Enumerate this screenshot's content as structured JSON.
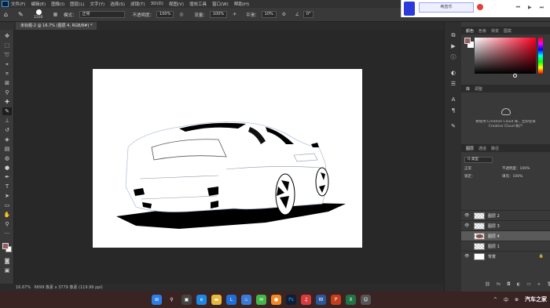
{
  "menubar": {
    "items": [
      "文件(F)",
      "编辑(E)",
      "图像(I)",
      "图层(L)",
      "文字(Y)",
      "选择(S)",
      "滤镜(T)",
      "3D(D)",
      "视图(V)",
      "增效工具",
      "窗口(W)",
      "帮助(H)"
    ]
  },
  "optbar": {
    "brush_size": "2200",
    "mode_label": "模式：",
    "mode_value": "正常",
    "opacity_label": "不透明度：",
    "opacity_value": "100%",
    "flow_label": "流量：",
    "flow_value": "100%",
    "smooth_label": "平滑：",
    "smooth_value": "10%",
    "angle_value": "0°"
  },
  "promo": {
    "name": "纯音乐"
  },
  "document": {
    "tab_title": "未标题-2 @ 16.7% (图层 4, RGB/8#) *"
  },
  "statusbar": {
    "zoom": "16.67%",
    "dimensions": "6699 像素 x 3779 像素 (119.99 ppi)"
  },
  "color_panel": {
    "tabs": [
      "颜色",
      "色板",
      "渐变",
      "图案"
    ],
    "fg_color": "#9a5a62",
    "bg_color": "#ffffff"
  },
  "library_panel": {
    "tabs": [
      "库",
      "调整"
    ],
    "message_line1": "要使用 Creative Cloud 库，立即登录",
    "message_line2": "Creative Cloud 帐户"
  },
  "layers_panel": {
    "tabs": [
      "图层",
      "通道",
      "路径"
    ],
    "filter": "Q 类型",
    "blend": "正常",
    "opacity": "不透明度：100%",
    "lock": "锁定：",
    "fill": "填充：100%",
    "layers": [
      {
        "name": "图层 2",
        "thumb": "check",
        "selected": false
      },
      {
        "name": "图层 3",
        "thumb": "check",
        "selected": false
      },
      {
        "name": "图层 4",
        "thumb": "mark",
        "selected": true
      },
      {
        "name": "图层 1",
        "thumb": "check",
        "selected": false
      },
      {
        "name": "背景",
        "thumb": "white",
        "selected": false
      }
    ]
  },
  "taskbar": {
    "tray_lang": "中",
    "watermark": "汽车之家"
  }
}
